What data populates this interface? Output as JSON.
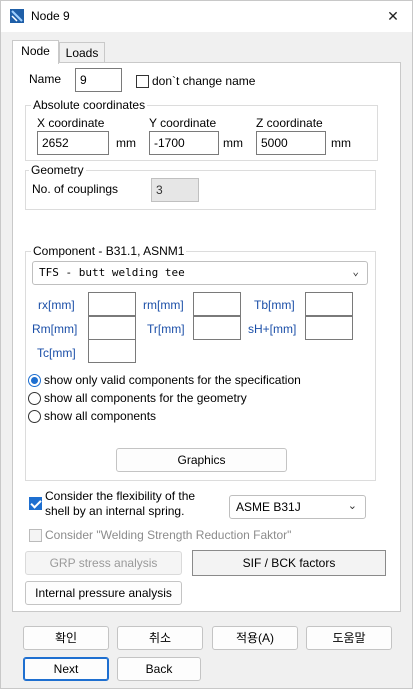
{
  "window": {
    "title": "Node 9",
    "close_glyph": "✕"
  },
  "tabs": [
    {
      "label": "Node"
    },
    {
      "label": "Loads"
    }
  ],
  "name": {
    "label": "Name",
    "value": "9",
    "dont_change_label": "don`t change name"
  },
  "absolute": {
    "title": "Absolute coordinates",
    "x_label": "X coordinate",
    "x_value": "2652",
    "y_label": "Y coordinate",
    "y_value": "-1700",
    "z_label": "Z coordinate",
    "z_value": "5000",
    "unit": "mm"
  },
  "geometry": {
    "title": "Geometry",
    "couplings_label": "No. of couplings",
    "couplings_value": "3"
  },
  "component": {
    "title": "Component - B31.1, ASNM1",
    "selected": "TFS - butt welding tee",
    "fields": {
      "rx": "rx[mm]",
      "rm": "rm[mm]",
      "tb": "Tb[mm]",
      "Rm": "Rm[mm]",
      "tr": "Tr[mm]",
      "sh": "sH+[mm]",
      "tc": "Tc[mm]"
    },
    "radios": [
      "show only valid components for the specification",
      "show all components for the geometry",
      "show all components"
    ],
    "graphics_label": "Graphics"
  },
  "flexibility": {
    "label_line1": "Consider the flexibility of the",
    "label_line2": "shell by an internal spring.",
    "standard": "ASME B31J"
  },
  "welding_label": "Consider \"Welding Strength Reduction Faktor\"",
  "buttons": {
    "grp": "GRP stress analysis",
    "sif": "SIF / BCK factors",
    "internal": "Internal pressure analysis",
    "ok": "확인",
    "cancel": "취소",
    "apply": "적용(A)",
    "help": "도움말",
    "next": "Next",
    "back": "Back"
  },
  "colors": {
    "accent": "#1e6fd0",
    "field_label": "#1b4fa8"
  }
}
